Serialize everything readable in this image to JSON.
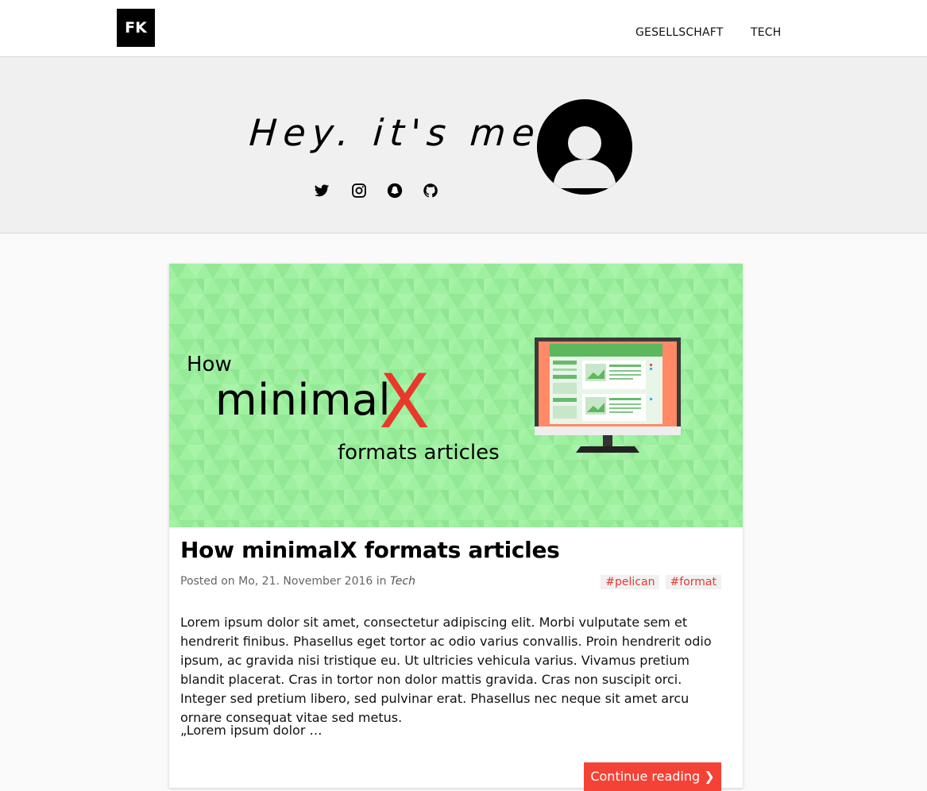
{
  "nav": {
    "logo": "FK",
    "links": [
      {
        "label": "GESELLSCHAFT"
      },
      {
        "label": "TECH"
      }
    ]
  },
  "hero": {
    "title": "Hey. it's me",
    "socials": [
      {
        "name": "twitter-icon"
      },
      {
        "name": "instagram-icon"
      },
      {
        "name": "snapchat-icon"
      },
      {
        "name": "github-icon"
      }
    ]
  },
  "post": {
    "banner": {
      "how": "How",
      "minimal": "minimal",
      "x": "X",
      "formats": "formats articles",
      "background_color": "#9ff0a0",
      "accent_color": "#e8392b"
    },
    "title": "How minimalX formats articles",
    "meta_prefix": "Posted on ",
    "date": "Mo, 21. November 2016",
    "meta_in": " in ",
    "category": "Tech",
    "tags": [
      "#pelican",
      "#format"
    ],
    "body": "Lorem ipsum dolor sit amet, consectetur adipiscing elit. Morbi vulputate sem et hendrerit finibus. Phasellus eget tortor ac odio varius convallis. Proin hendrerit odio ipsum, ac gravida nisi tristique eu. Ut ultricies vehicula varius. Vivamus pretium blandit placerat. Cras in tortor non dolor mattis gravida. Cras non suscipit orci. Integer sed pretium libero, sed pulvinar erat. Phasellus nec neque sit amet arcu ornare consequat vitae sed metus.",
    "excerpt": "„Lorem ipsum dolor …",
    "continue_label": "Continue reading ❯"
  },
  "colors": {
    "accent": "#f44336",
    "tag_text": "#e53935",
    "hero_bg": "#f0f0f0"
  }
}
